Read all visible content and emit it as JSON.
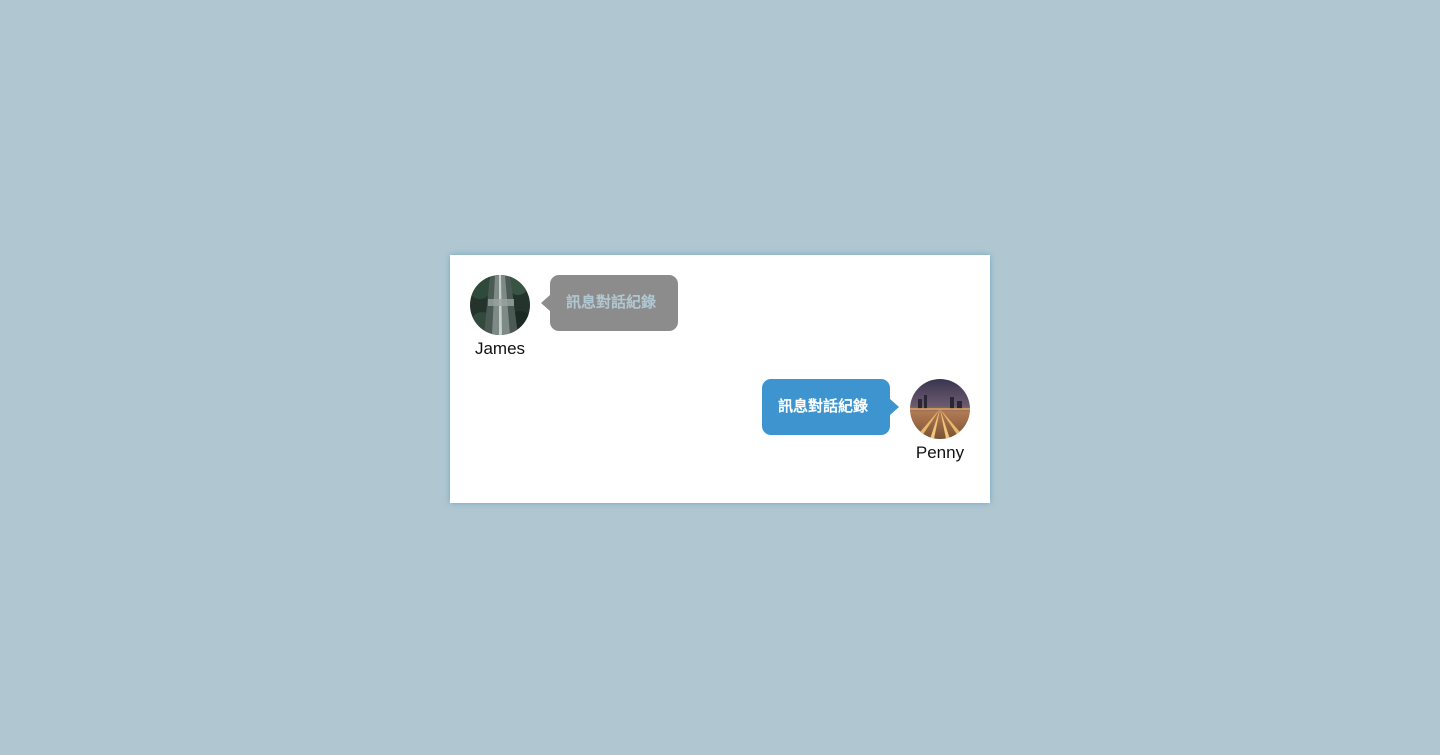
{
  "colors": {
    "page_background": "#b0c7d1",
    "card_background": "#ffffff",
    "incoming_bubble": "#8c8c8c",
    "incoming_text": "#b0c7d1",
    "outgoing_bubble": "#3d94cf",
    "outgoing_text": "#ffffff"
  },
  "messages": [
    {
      "side": "left",
      "sender": "James",
      "text": "訊息對話紀錄",
      "avatar_icon": "forest-road-photo-avatar"
    },
    {
      "side": "right",
      "sender": "Penny",
      "text": "訊息對話紀錄",
      "avatar_icon": "city-railway-night-photo-avatar"
    }
  ]
}
